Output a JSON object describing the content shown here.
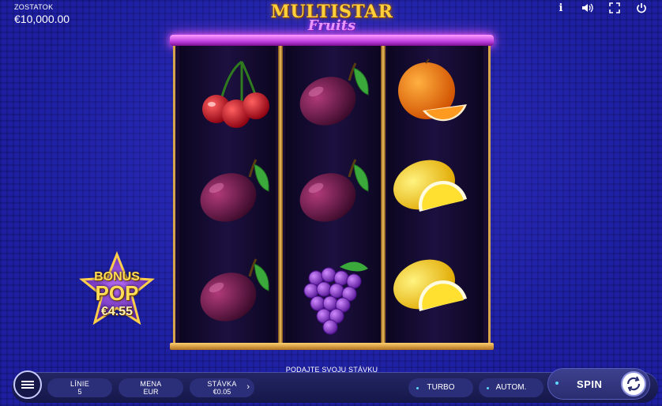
{
  "balance": {
    "label": "ZOSTATOK",
    "value": "€10,000.00"
  },
  "logo": {
    "line1": "MULTISTAR",
    "line2": "Fruits"
  },
  "top_icons": [
    "info-icon",
    "sound-icon",
    "fullscreen-icon",
    "power-icon"
  ],
  "top_info_glyph": "i",
  "reels": [
    [
      "cherries",
      "plum",
      "plum"
    ],
    [
      "plum",
      "plum",
      "grapes"
    ],
    [
      "orange",
      "lemon",
      "lemon"
    ]
  ],
  "bonus": {
    "line1": "BONUS",
    "line2": "POP",
    "amount": "€4.55"
  },
  "hint": "PODAJTE SVOJU STÁVKU",
  "controls": {
    "lines": {
      "label": "LÍNIE",
      "value": "5"
    },
    "currency": {
      "label": "MENA",
      "value": "EUR"
    },
    "bet": {
      "label": "STÁVKA",
      "value": "€0.05",
      "arrow": "›"
    },
    "turbo": "TURBO",
    "auto": "AUTOM.",
    "spin": "SPIN"
  },
  "colors": {
    "background": "#1d1fa0",
    "marquee": "#ff9cff",
    "frame_gold": "#d6a54a",
    "accent": "#5fd7ff"
  }
}
